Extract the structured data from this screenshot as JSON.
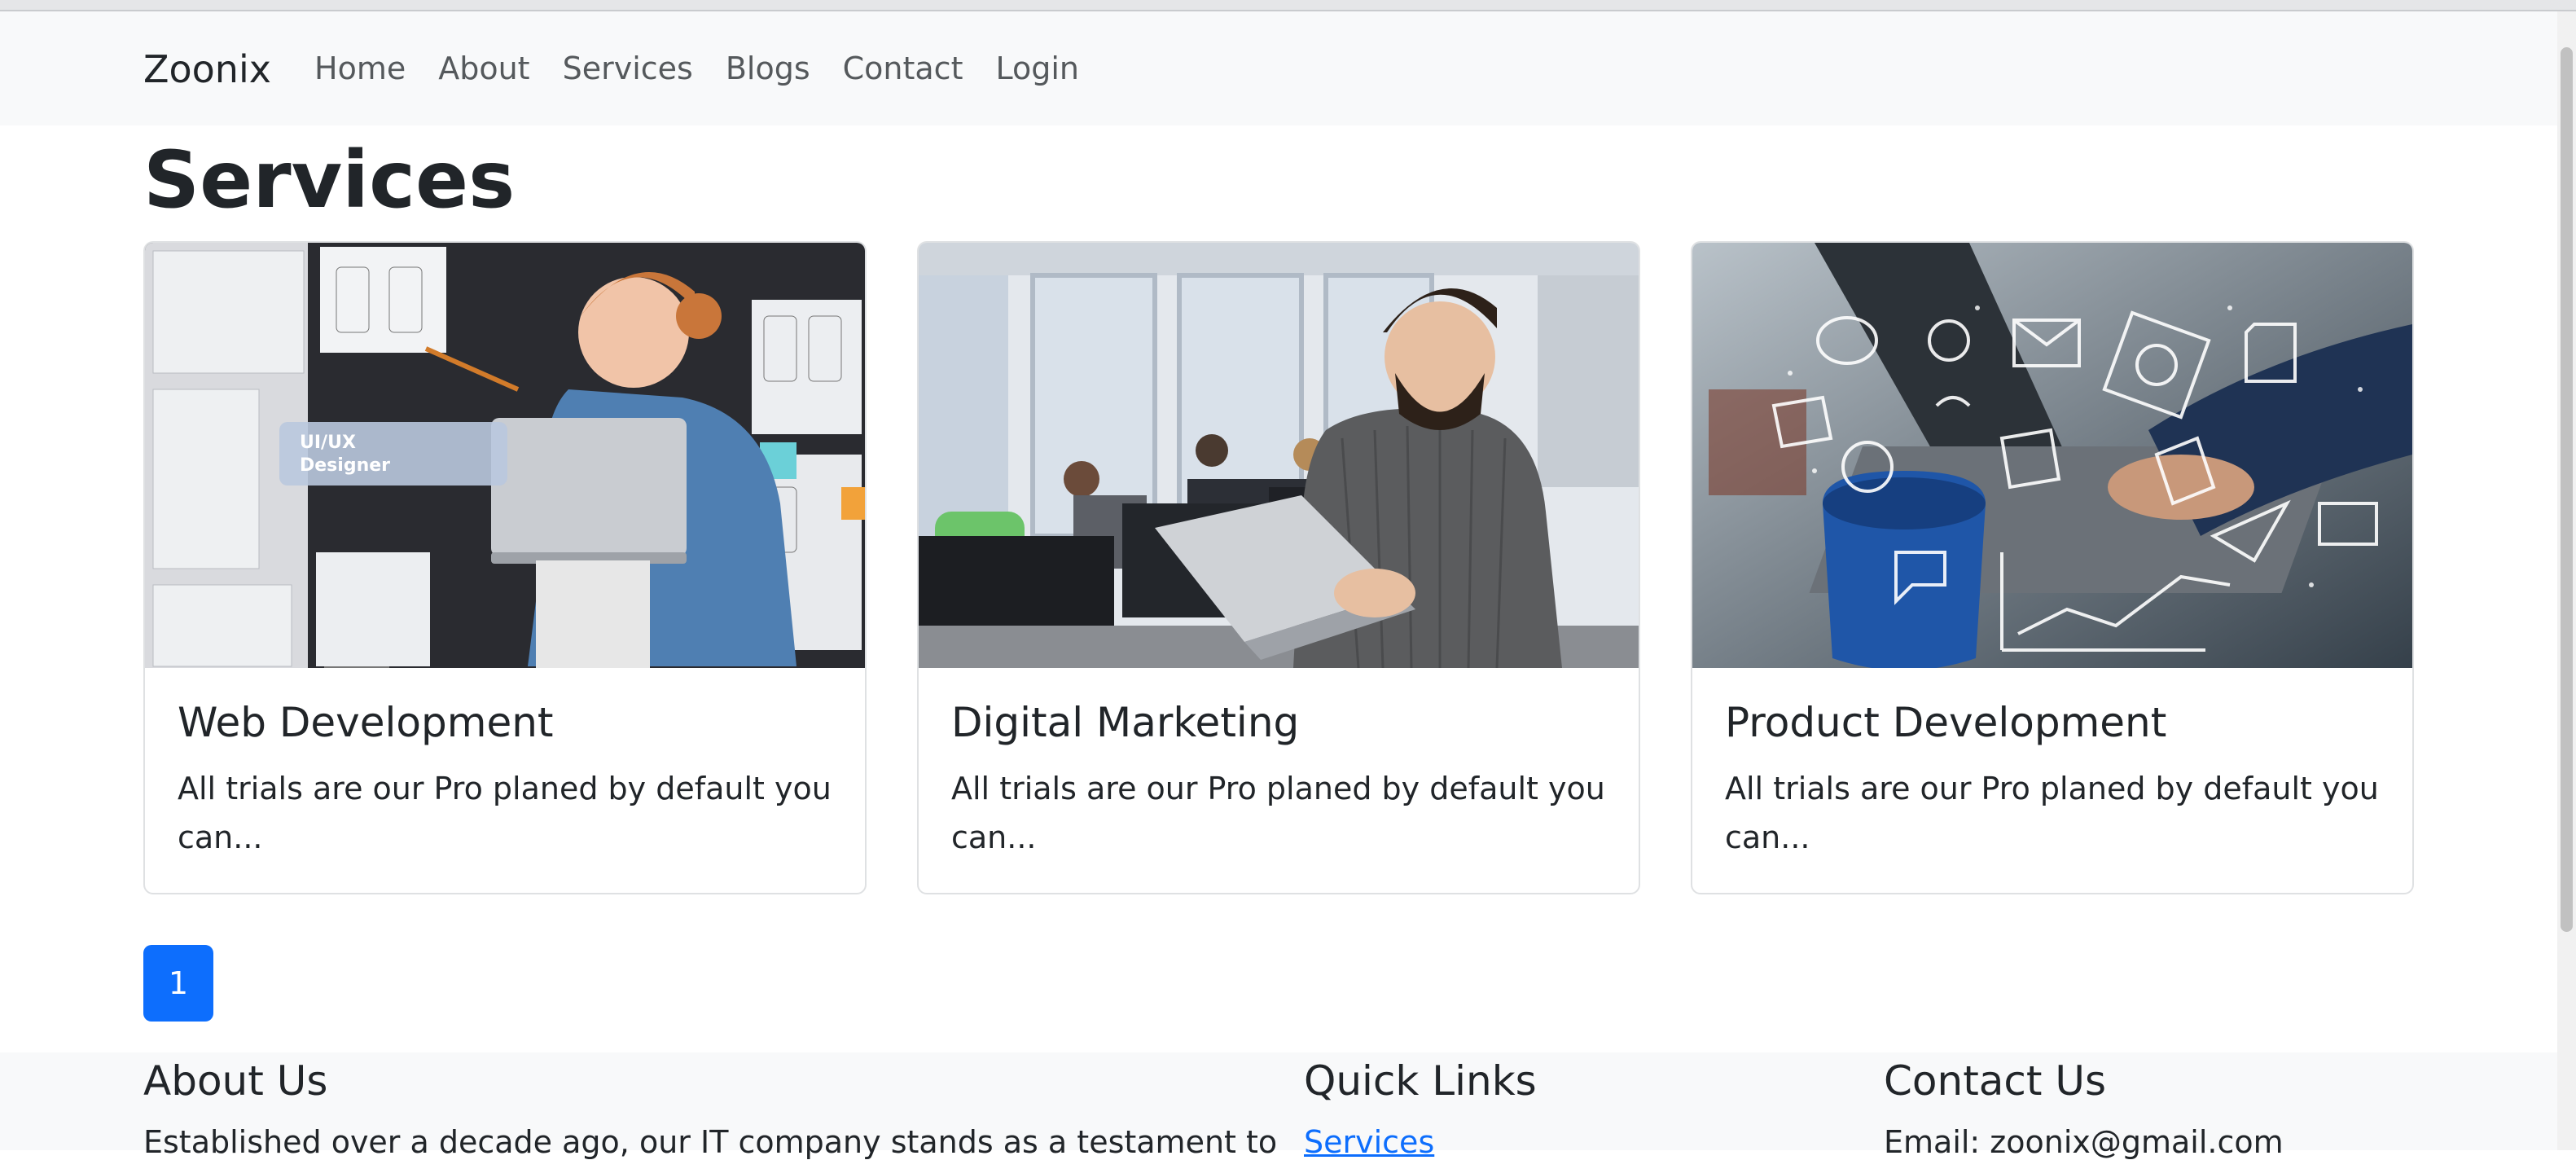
{
  "navbar": {
    "brand": "Zoonix",
    "links": [
      "Home",
      "About",
      "Services",
      "Blogs",
      "Contact",
      "Login"
    ]
  },
  "page": {
    "title": "Services"
  },
  "cards": [
    {
      "title": "Web Development",
      "text": "All trials are our Pro planed by default you can...",
      "badge": "UI/UX Designer"
    },
    {
      "title": "Digital Marketing",
      "text": "All trials are our Pro planed by default you can..."
    },
    {
      "title": "Product Development",
      "text": "All trials are our Pro planed by default you can..."
    }
  ],
  "pagination": {
    "current": "1"
  },
  "footer": {
    "about": {
      "heading": "About Us",
      "text": "Established over a decade ago, our IT company stands as a testament to"
    },
    "quick_links": {
      "heading": "Quick Links",
      "first_link": "Services"
    },
    "contact": {
      "heading": "Contact Us",
      "email": "Email: zoonix@gmail.com"
    }
  },
  "colors": {
    "primary": "#0d6efd",
    "navbar_bg": "#f8f9fa",
    "text": "#212529"
  }
}
